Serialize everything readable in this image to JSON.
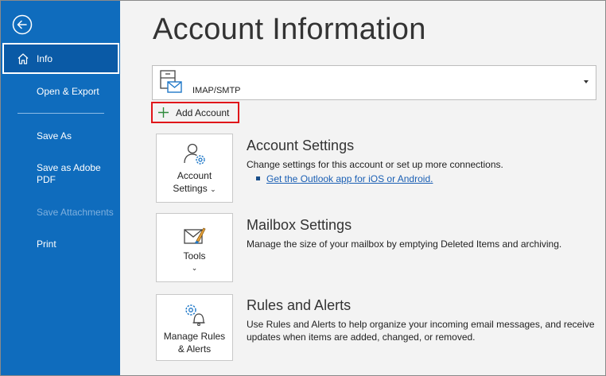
{
  "sidebar": {
    "info_label": "Info",
    "items": [
      {
        "label": "Open & Export"
      },
      {
        "label": "Save As"
      },
      {
        "label": "Save as Adobe PDF"
      },
      {
        "label": "Save Attachments"
      },
      {
        "label": "Print"
      }
    ]
  },
  "main": {
    "title": "Account Information",
    "account": {
      "label": "IMAP/SMTP"
    },
    "add_account_label": "Add Account",
    "sections": [
      {
        "tile_line1": "Account",
        "tile_line2": "Settings",
        "tile_chevron": "⌄",
        "title": "Account Settings",
        "description": "Change settings for this account or set up more connections.",
        "link": "Get the Outlook app for iOS or Android."
      },
      {
        "tile_line1": "Tools",
        "tile_chevron": "⌄",
        "title": "Mailbox Settings",
        "description": "Manage the size of your mailbox by emptying Deleted Items and archiving."
      },
      {
        "tile_line1": "Manage Rules",
        "tile_line2": "& Alerts",
        "title": "Rules and Alerts",
        "description": "Use Rules and Alerts to help organize your incoming email messages, and receive updates when items are added, changed, or removed."
      }
    ]
  },
  "colors": {
    "sidebar_bg": "#0f6cbd",
    "highlight_border": "#e0161a",
    "link": "#1a5fb4"
  },
  "icons": [
    "back-arrow-icon",
    "home-icon",
    "account-mailbox-icon",
    "plus-icon",
    "account-settings-icon",
    "tools-icon",
    "rules-alerts-icon"
  ]
}
